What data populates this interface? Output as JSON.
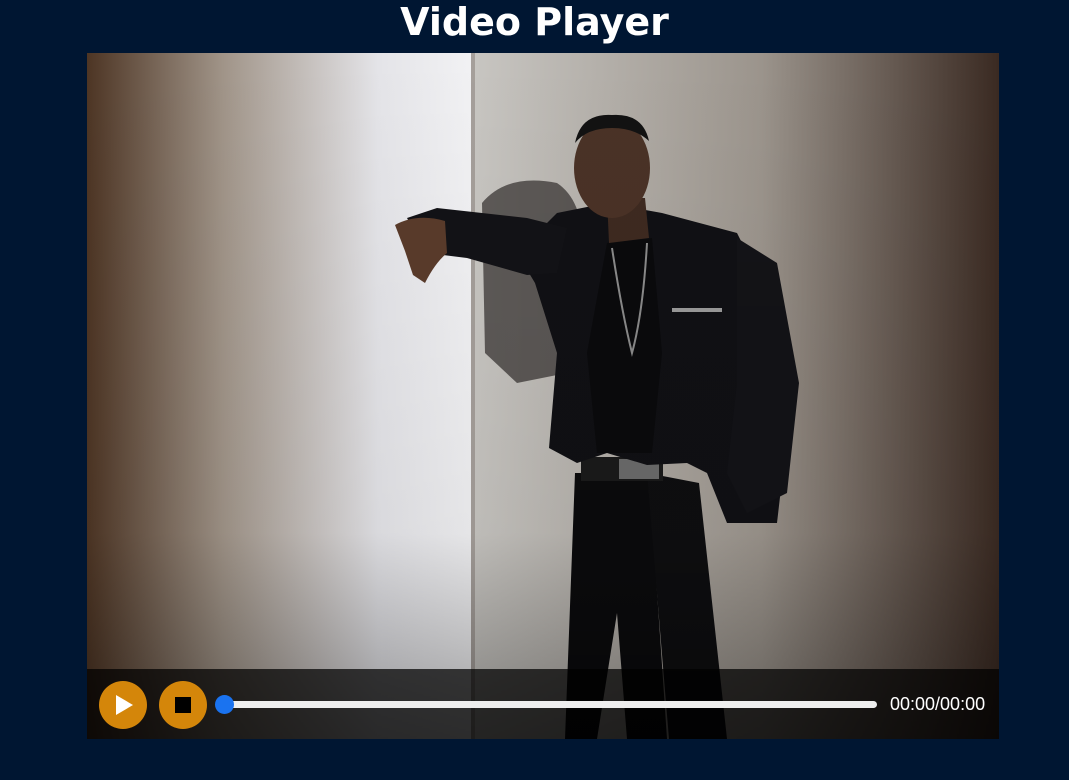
{
  "page": {
    "title": "Video Player"
  },
  "player": {
    "poster": "man in black jacket leaning on a white wall",
    "controls": {
      "play_icon": "play-icon",
      "stop_icon": "stop-icon",
      "progress": 0,
      "time_text": "00:00/00:00"
    }
  },
  "colors": {
    "background": "#001632",
    "button": "#d4860a",
    "progress_thumb": "#1a73f0",
    "progress_track": "#eeeeee"
  }
}
